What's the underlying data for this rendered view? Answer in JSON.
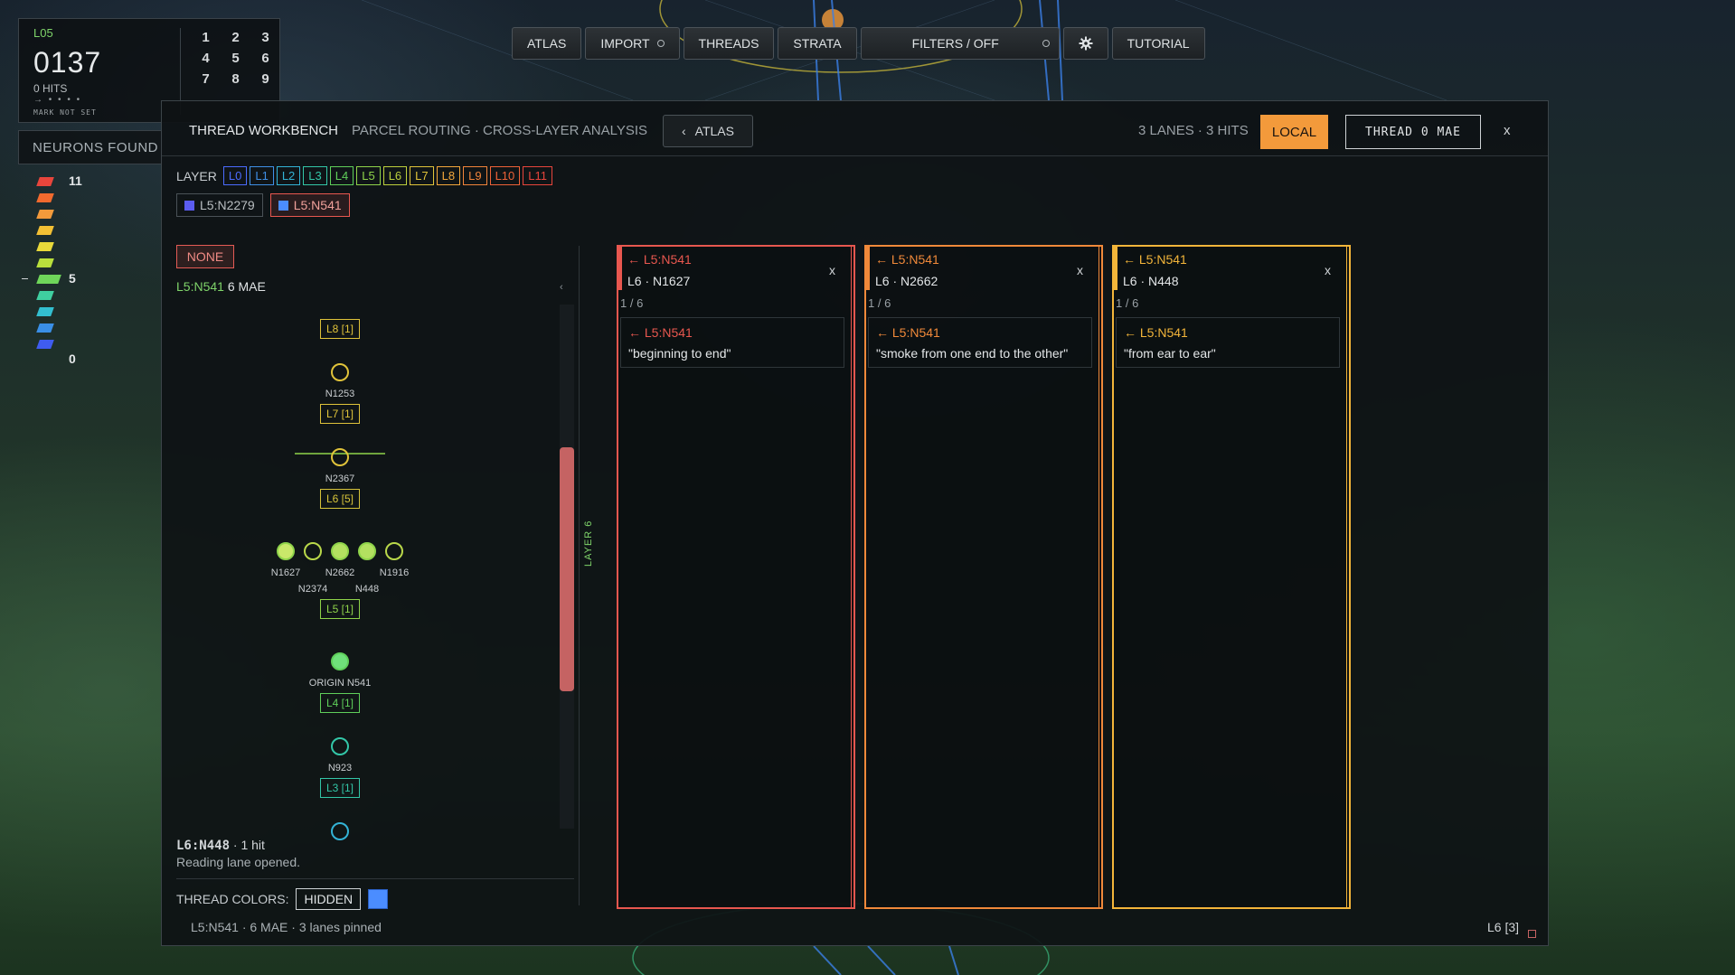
{
  "hud": {
    "level": "L05",
    "score": "0137",
    "hits": "0 HITS",
    "dots": "→ • • • •",
    "mark": "MARK NOT SET",
    "keypad": [
      "1",
      "2",
      "3",
      "4",
      "5",
      "6",
      "7",
      "8",
      "9"
    ]
  },
  "neurons_tab": "NEURONS FOUND",
  "ramp": {
    "labels": [
      "11",
      "5",
      "0"
    ],
    "colors": [
      "#e8453c",
      "#f26a2e",
      "#f39a3b",
      "#f3c034",
      "#e8d93a",
      "#b9e03c",
      "#6fd65a",
      "#3fcfa0",
      "#33bfd0",
      "#3a8fe6",
      "#3f5cf0"
    ]
  },
  "toolbar": {
    "atlas": "ATLAS",
    "import": "IMPORT",
    "threads": "THREADS",
    "strata": "STRATA",
    "filters": "FILTERS / OFF",
    "settings_icon": "gear-icon",
    "tutorial": "TUTORIAL"
  },
  "panel": {
    "title": "THREAD WORKBENCH",
    "subtitle": "PARCEL ROUTING · CROSS-LAYER ANALYSIS",
    "back_label": "ATLAS",
    "summary": "3 LANES · 3 HITS",
    "local": "LOCAL",
    "thread": "THREAD 0 MAE",
    "close": "x"
  },
  "layers": {
    "label": "LAYER",
    "chips": [
      {
        "name": "L0",
        "color": "#4b6bff"
      },
      {
        "name": "L1",
        "color": "#3f8fe6"
      },
      {
        "name": "L2",
        "color": "#33b3d6"
      },
      {
        "name": "L3",
        "color": "#33c7a8"
      },
      {
        "name": "L4",
        "color": "#5fcf5a"
      },
      {
        "name": "L5",
        "color": "#8fd44a"
      },
      {
        "name": "L6",
        "color": "#bdd03c"
      },
      {
        "name": "L7",
        "color": "#e0c33a"
      },
      {
        "name": "L8",
        "color": "#f3a73b"
      },
      {
        "name": "L9",
        "color": "#f2843a"
      },
      {
        "name": "L10",
        "color": "#ee6237"
      },
      {
        "name": "L11",
        "color": "#e8453c"
      }
    ]
  },
  "selections": [
    {
      "label": "L5:N2279",
      "color": "#5b5cf0"
    },
    {
      "label": "L5:N541",
      "color": "#4b8dff"
    }
  ],
  "none_button": "NONE",
  "mae": {
    "id": "L5:N541",
    "value": "6 MAE"
  },
  "tree": {
    "n1253": "N1253",
    "n2367": "N2367",
    "n923": "N923",
    "origin": "ORIGIN N541",
    "row": [
      "N1627",
      "N2374",
      "N2662",
      "N448",
      "N1916"
    ],
    "boxes": [
      "L8 [1]",
      "L7 [1]",
      "L6 [5]",
      "L5 [1]",
      "L4 [1]",
      "L3 [1]"
    ]
  },
  "status": {
    "node": "L6:N448",
    "hits": " · 1 hit",
    "message": "Reading lane opened."
  },
  "thread_colors": {
    "label": "THREAD COLORS:",
    "hidden": "HIDDEN",
    "swatch": "#4b8dff"
  },
  "footer": "L5:N541 · 6 MAE · 3 lanes pinned",
  "layer_vertical": "LAYER 6",
  "lanes": [
    {
      "color": "#e8574f",
      "from": "← L5:N541",
      "node": "L6 · N1627",
      "page": "1 / 6",
      "card_from": "← L5:N541",
      "quote": "\"beginning to end\"",
      "close": "x"
    },
    {
      "color": "#f0893a",
      "from": "← L5:N541",
      "node": "L6 · N2662",
      "page": "1 / 6",
      "card_from": "← L5:N541",
      "quote": "\"smoke from one end to the other\"",
      "close": "x"
    },
    {
      "color": "#f3b53a",
      "from": "← L5:N541",
      "node": "L6 · N448",
      "page": "1 / 6",
      "card_from": "← L5:N541",
      "quote": "\"from ear to ear\"",
      "close": "x"
    }
  ],
  "bottom_right": "L6 [3]"
}
